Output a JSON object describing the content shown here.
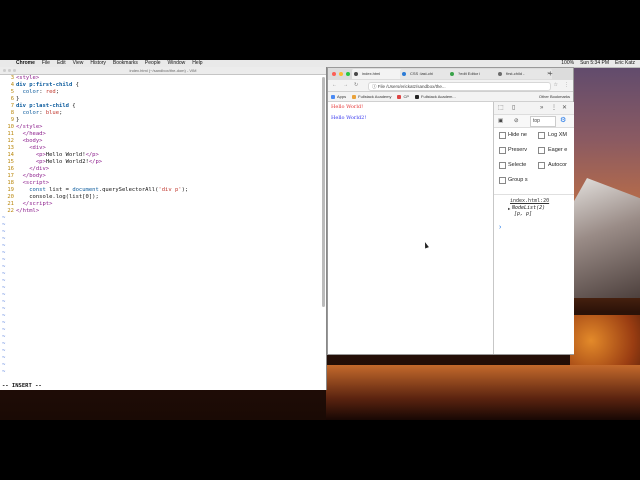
{
  "menubar": {
    "apple": "",
    "items": [
      "Chrome",
      "File",
      "Edit",
      "View",
      "History",
      "Bookmarks",
      "People",
      "Window",
      "Help"
    ],
    "right": [
      "100%",
      "Sun 5:34 PM",
      "Eric Katz"
    ]
  },
  "vim": {
    "title": "index.html (~/sandbox/the-dom) - VIM",
    "lines": [
      {
        "n": "3",
        "html": "<span class='tag'>&lt;style&gt;</span>"
      },
      {
        "n": "4",
        "html": "<span class='sel'>div p:first-child</span> {"
      },
      {
        "n": "5",
        "html": "  <span class='kw'>color</span>: <span class='str'>red</span>;"
      },
      {
        "n": "6",
        "html": "}"
      },
      {
        "n": "7",
        "html": "<span class='sel'>div p:last-child</span> {"
      },
      {
        "n": "8",
        "html": "  <span class='kw'>color</span>: <span class='str'>blue</span>;"
      },
      {
        "n": "9",
        "html": "}"
      },
      {
        "n": "10",
        "html": "<span class='tag'>&lt;/style&gt;</span>"
      },
      {
        "n": "11",
        "html": "  <span class='tag'>&lt;/head&gt;</span>"
      },
      {
        "n": "12",
        "html": "  <span class='tag'>&lt;body&gt;</span>"
      },
      {
        "n": "13",
        "html": "    <span class='tag'>&lt;div&gt;</span>"
      },
      {
        "n": "14",
        "html": "      <span class='tag'>&lt;p&gt;</span>Hello World!<span class='tag'>&lt;/p&gt;</span>"
      },
      {
        "n": "15",
        "html": "      <span class='tag'>&lt;p&gt;</span>Hello World2!<span class='tag'>&lt;/p&gt;</span>"
      },
      {
        "n": "16",
        "html": "    <span class='tag'>&lt;/div&gt;</span>"
      },
      {
        "n": "17",
        "html": "  <span class='tag'>&lt;/body&gt;</span>"
      },
      {
        "n": "18",
        "html": "  <span class='tag'>&lt;script&gt;</span>"
      },
      {
        "n": "19",
        "html": "    <span class='kw'>const</span> list = <span class='kw'>document</span>.querySelectorAll(<span class='str'>'div p'</span>);"
      },
      {
        "n": "20",
        "html": "    console.log(list[0]);"
      },
      {
        "n": "21",
        "html": "  <span class='tag'>&lt;/script&gt;</span>"
      },
      {
        "n": "22",
        "html": "<span class='tag'>&lt;/html&gt;</span>"
      }
    ],
    "status": "-- INSERT --"
  },
  "chrome": {
    "tabs": [
      {
        "label": "index.html",
        "active": true
      },
      {
        "label": "CSS :last-chi",
        "active": false
      },
      {
        "label": "?edit Editor i",
        "active": false
      },
      {
        "label": "first-child -",
        "active": false
      }
    ],
    "url": "/Users/erickatz/sandbox/the...",
    "url_prefix": "File",
    "bookmarks": [
      "Apps",
      "Fullstack Academy",
      "CP",
      "Fullstack Academ..."
    ],
    "other_bookmarks": "Other Bookmarks",
    "page_lines": [
      "Hello World!",
      "Hello World2!"
    ],
    "colors": {
      "first": "#e53333",
      "second": "#3333ee"
    }
  },
  "devtools": {
    "context": "top",
    "options": [
      {
        "left": "Hide ne",
        "right": "Log XM"
      },
      {
        "left": "Preserv",
        "right": "Eager e"
      },
      {
        "left": "Selecte",
        "right": "Autocor"
      },
      {
        "left": "Group s",
        "right": ""
      }
    ],
    "log_source": "index.html:20",
    "log_obj": "NodeList(2)",
    "log_items": "[p, p]",
    "prompt": "›"
  }
}
